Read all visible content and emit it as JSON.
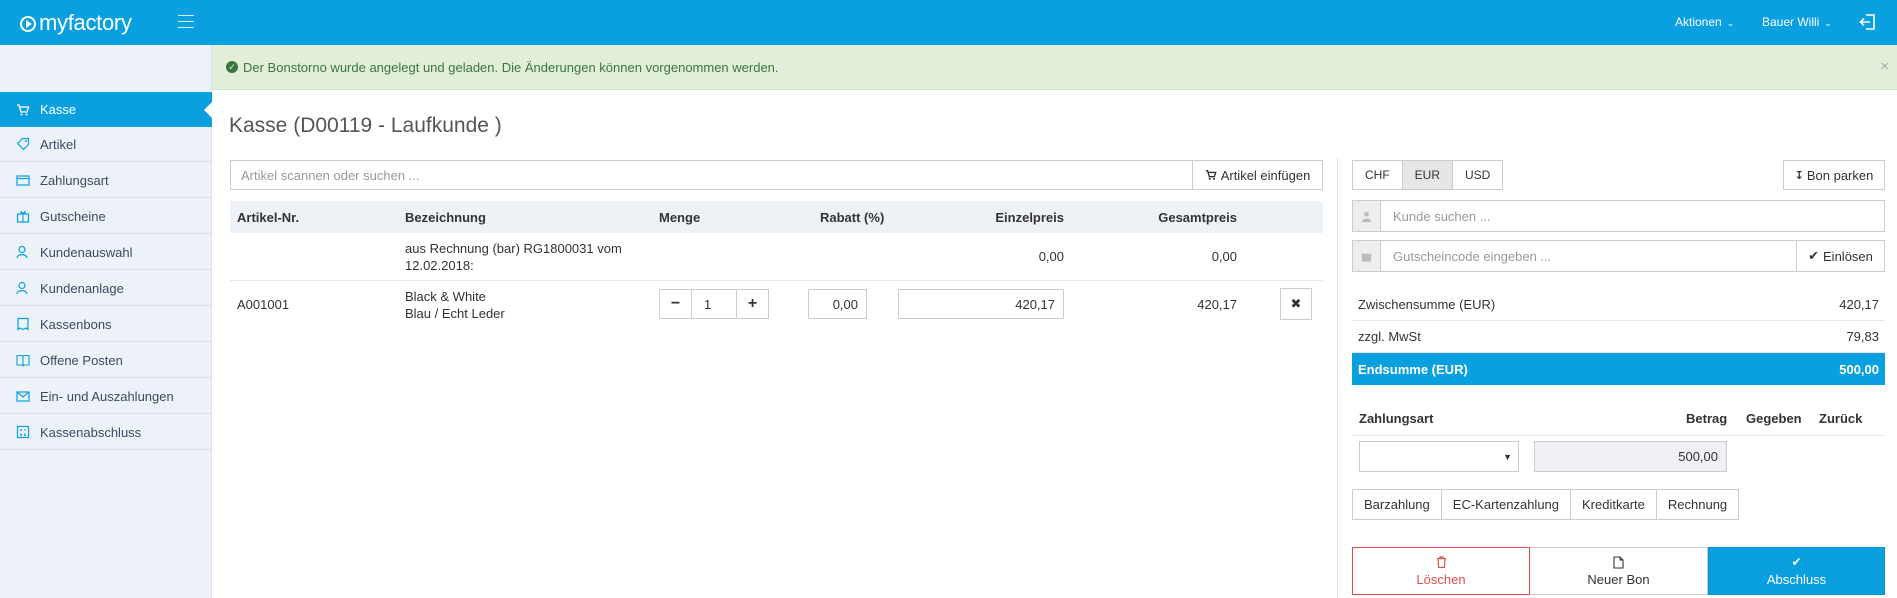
{
  "header": {
    "logo_text": "myfactory",
    "actions_label": "Aktionen",
    "user_label": "Bauer Willi"
  },
  "sidebar": {
    "items": [
      {
        "label": "Kasse",
        "icon": "cart-icon",
        "active": true
      },
      {
        "label": "Artikel",
        "icon": "tag-icon"
      },
      {
        "label": "Zahlungsart",
        "icon": "wallet-icon"
      },
      {
        "label": "Gutscheine",
        "icon": "gift-icon"
      },
      {
        "label": "Kundenauswahl",
        "icon": "user-search-icon"
      },
      {
        "label": "Kundenanlage",
        "icon": "user-add-icon"
      },
      {
        "label": "Kassenbons",
        "icon": "receipt-icon"
      },
      {
        "label": "Offene Posten",
        "icon": "book-icon"
      },
      {
        "label": "Ein- und Auszahlungen",
        "icon": "envelope-icon"
      },
      {
        "label": "Kassenabschluss",
        "icon": "calculator-icon"
      }
    ]
  },
  "alert": {
    "message": "Der Bonstorno wurde angelegt und geladen. Die Änderungen können vorgenommen werden.",
    "close": "×"
  },
  "page": {
    "title": "Kasse (D00119 - Laufkunde )"
  },
  "article_search": {
    "placeholder": "Artikel scannen oder suchen ...",
    "add_button": "Artikel einfügen"
  },
  "table": {
    "headers": {
      "article_no": "Artikel-Nr.",
      "description": "Bezeichnung",
      "quantity": "Menge",
      "discount": "Rabatt (%)",
      "unit_price": "Einzelpreis",
      "total_price": "Gesamtpreis"
    },
    "rows": [
      {
        "article_no": "",
        "description_line1": "aus Rechnung (bar) RG1800031 vom",
        "description_line2": "12.02.2018:",
        "unit_price": "0,00",
        "total_price": "0,00"
      },
      {
        "article_no": "A001001",
        "description_line1": "Black & White",
        "description_line2": "Blau / Echt Leder",
        "quantity": "1",
        "discount": "0,00",
        "unit_price": "420,17",
        "total_price": "420,17"
      }
    ]
  },
  "currency": {
    "options": [
      "CHF",
      "EUR",
      "USD"
    ],
    "selected": "EUR"
  },
  "park_button": "Bon parken",
  "customer_search": {
    "placeholder": "Kunde suchen ..."
  },
  "voucher": {
    "placeholder": "Gutscheincode eingeben ...",
    "redeem_button": "Einlösen"
  },
  "summary": {
    "subtotal_label": "Zwischensumme (EUR)",
    "subtotal_value": "420,17",
    "vat_label": "zzgl. MwSt",
    "vat_value": "79,83",
    "total_label": "Endsumme (EUR)",
    "total_value": "500,00"
  },
  "payment": {
    "headers": {
      "method": "Zahlungsart",
      "amount": "Betrag",
      "given": "Gegeben",
      "change": "Zurück"
    },
    "selected_method": "",
    "amount_value": "500,00",
    "methods": [
      "Barzahlung",
      "EC-Kartenzahlung",
      "Kreditkarte",
      "Rechnung"
    ]
  },
  "actions": {
    "delete": "Löschen",
    "new_receipt": "Neuer Bon",
    "finish": "Abschluss"
  },
  "colors": {
    "primary": "#0aa0e0",
    "alert_bg": "#e1efd8",
    "alert_text": "#3c763d",
    "danger": "#d9534f"
  }
}
